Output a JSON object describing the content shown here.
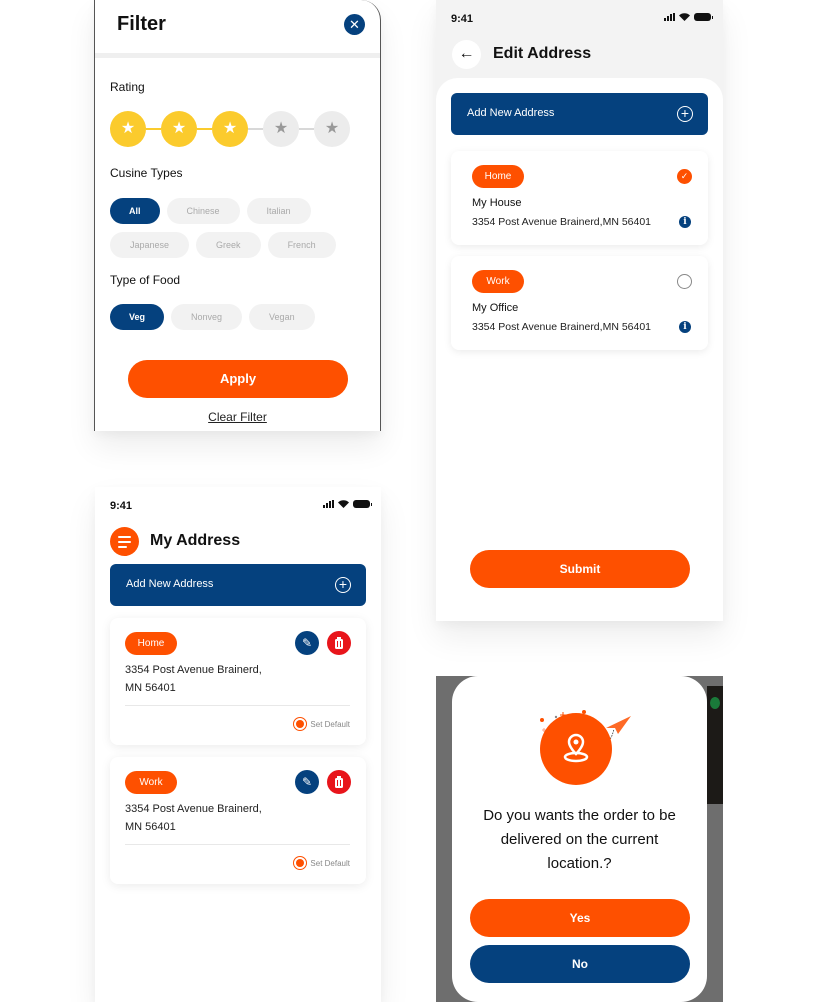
{
  "colors": {
    "primary_orange": "#fe5000",
    "navy": "#05417e",
    "star_yellow": "#fbcb2d",
    "delete_red": "#e8151b"
  },
  "filter": {
    "title": "Filter",
    "close_icon": "close-icon",
    "rating_label": "Rating",
    "rating": {
      "value": 3,
      "max": 5
    },
    "cuisine_label": "Cusine Types",
    "cuisines": [
      {
        "label": "All",
        "selected": true
      },
      {
        "label": "Chinese",
        "selected": false
      },
      {
        "label": "Italian",
        "selected": false
      },
      {
        "label": "Japanese",
        "selected": false
      },
      {
        "label": "Greek",
        "selected": false
      },
      {
        "label": "French",
        "selected": false
      }
    ],
    "food_label": "Type of Food",
    "foods": [
      {
        "label": "Veg",
        "selected": true
      },
      {
        "label": "Nonveg",
        "selected": false
      },
      {
        "label": "Vegan",
        "selected": false
      }
    ],
    "apply_label": "Apply",
    "clear_label": "Clear Filter"
  },
  "edit_address": {
    "time": "9:41",
    "title": "Edit Address",
    "add_label": "Add New Address",
    "addresses": [
      {
        "tag": "Home",
        "name": "My House",
        "address": "3354 Post Avenue Brainerd,MN 56401",
        "selected": true
      },
      {
        "tag": "Work",
        "name": "My Office",
        "address": "3354 Post Avenue Brainerd,MN 56401",
        "selected": false
      }
    ],
    "submit_label": "Submit"
  },
  "my_address": {
    "time": "9:41",
    "title": "My Address",
    "add_label": "Add New Address",
    "addresses": [
      {
        "tag": "Home",
        "line1": "3354 Post Avenue Brainerd,",
        "line2": "MN 56401",
        "set_default": "Set Default"
      },
      {
        "tag": "Work",
        "line1": "3354 Post Avenue Brainerd,",
        "line2": "MN 56401",
        "set_default": "Set Default"
      }
    ]
  },
  "confirm": {
    "question": "Do you wants the order to be delivered on the current location.?",
    "yes_label": "Yes",
    "no_label": "No"
  },
  "icons": {
    "star": "★",
    "back": "←",
    "plus": "+",
    "check": "✓",
    "info": "i",
    "edit": "✎",
    "delete": "🗑"
  }
}
